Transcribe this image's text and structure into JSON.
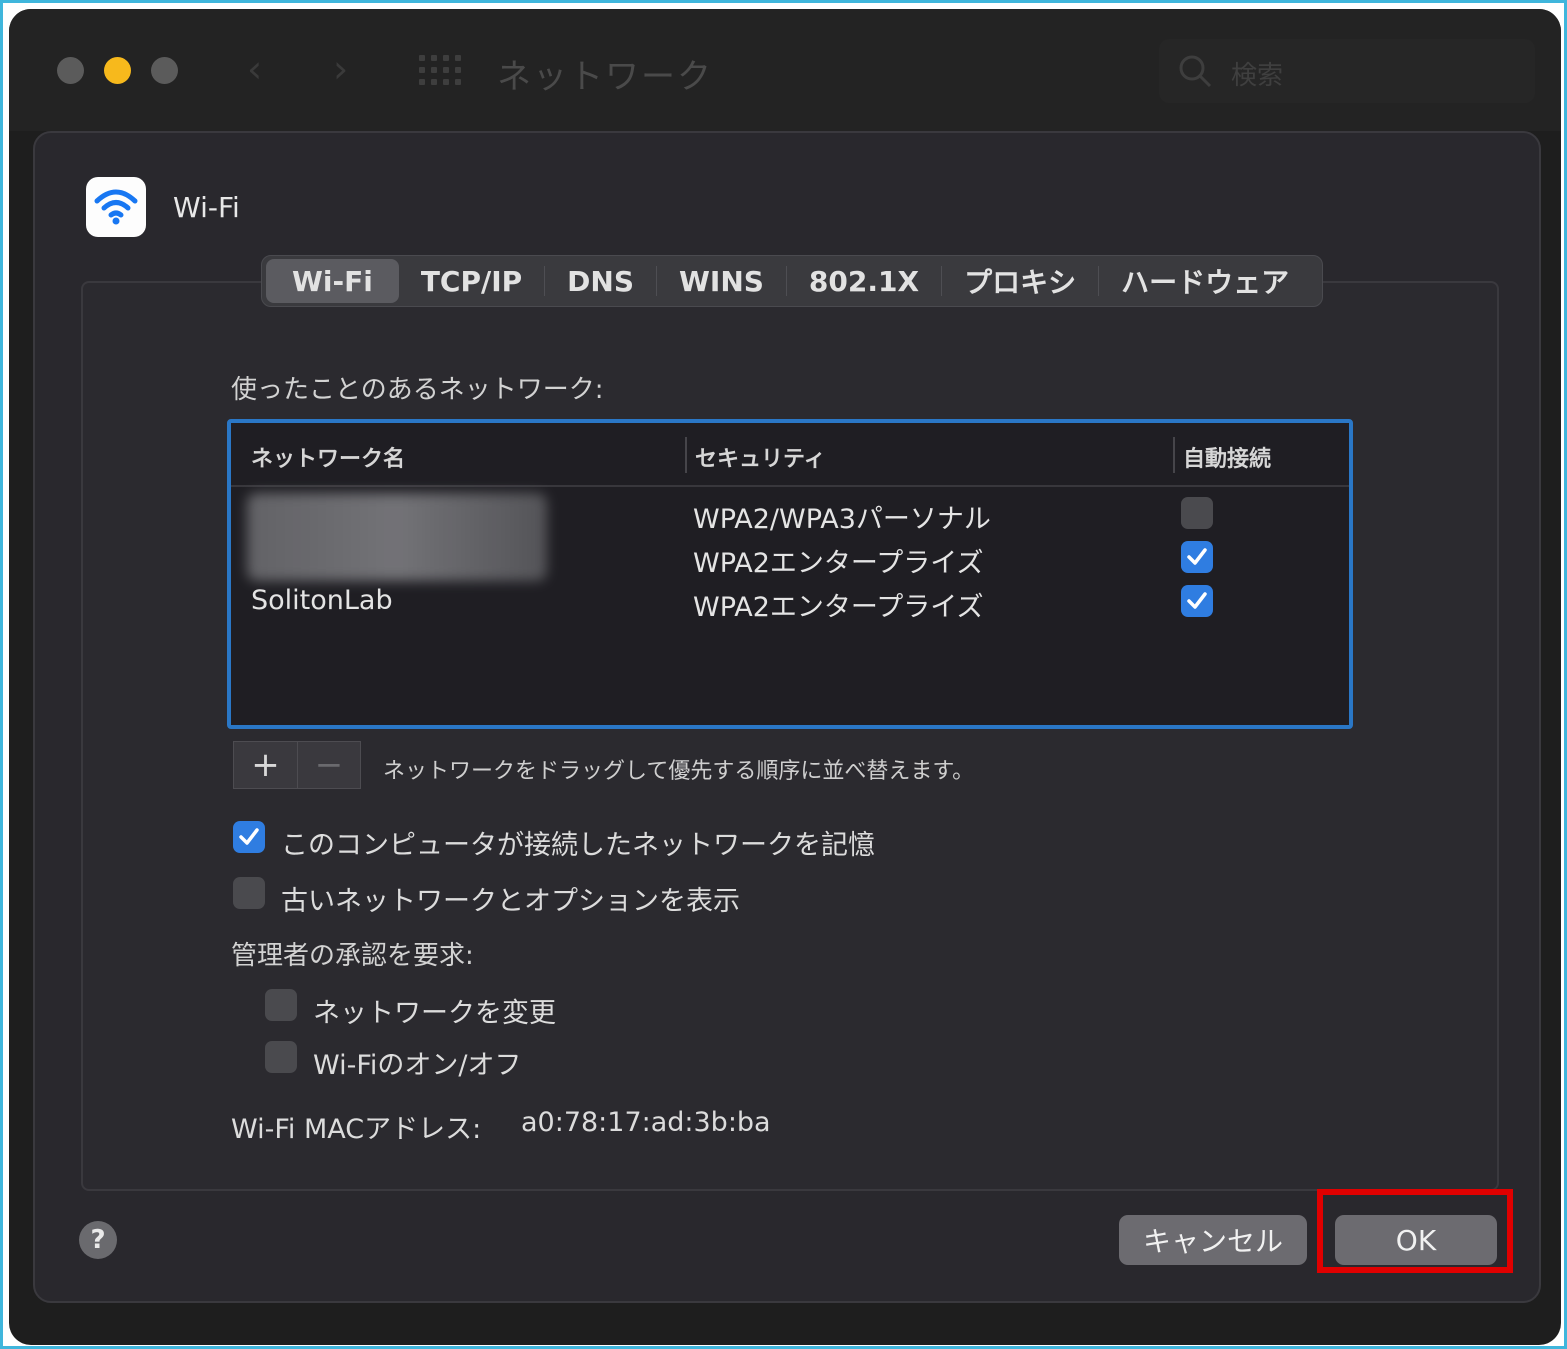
{
  "window": {
    "title": "ネットワーク",
    "search_placeholder": "検索"
  },
  "sheet": {
    "service_title": "Wi-Fi",
    "tabs": [
      "Wi-Fi",
      "TCP/IP",
      "DNS",
      "WINS",
      "802.1X",
      "プロキシ",
      "ハードウェア"
    ],
    "active_tab": "Wi-Fi",
    "known_networks_label": "使ったことのあるネットワーク:",
    "table": {
      "headers": [
        "ネットワーク名",
        "セキュリティ",
        "自動接続"
      ],
      "rows": [
        {
          "name": "",
          "security": "WPA2/WPA3パーソナル",
          "auto_join": false
        },
        {
          "name": "",
          "security": "WPA2エンタープライズ",
          "auto_join": true
        },
        {
          "name": "SolitonLab",
          "security": "WPA2エンタープライズ",
          "auto_join": true
        }
      ]
    },
    "add_symbol": "+",
    "remove_symbol": "−",
    "drag_hint": "ネットワークをドラッグして優先する順序に並べ替えます。",
    "options": [
      {
        "label": "このコンピュータが接続したネットワークを記憶",
        "checked": true
      },
      {
        "label": "古いネットワークとオプションを表示",
        "checked": false
      }
    ],
    "admin_label": "管理者の承認を要求:",
    "admin_options": [
      {
        "label": "ネットワークを変更",
        "checked": false
      },
      {
        "label": "Wi-Fiのオン/オフ",
        "checked": false
      }
    ],
    "mac_label": "Wi-Fi MACアドレス:",
    "mac_value": "a0:78:17:ad:3b:ba",
    "help_symbol": "?",
    "cancel_label": "キャンセル",
    "ok_label": "OK"
  },
  "colors": {
    "accent": "#2f7de1",
    "table_focus": "#2a77c6",
    "highlight": "#e00000",
    "frame": "#3fb6dc"
  }
}
